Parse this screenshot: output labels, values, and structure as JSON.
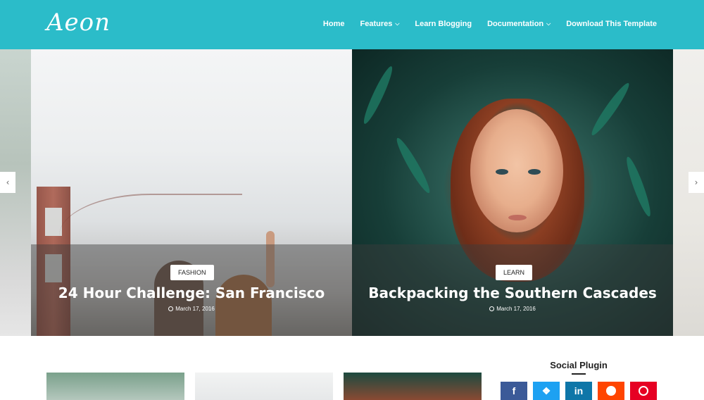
{
  "header": {
    "logo_text": "Aeon",
    "nav": [
      {
        "label": "Home",
        "has_dropdown": false
      },
      {
        "label": "Features",
        "has_dropdown": true
      },
      {
        "label": "Learn Blogging",
        "has_dropdown": false
      },
      {
        "label": "Documentation",
        "has_dropdown": true
      },
      {
        "label": "Download This Template",
        "has_dropdown": false
      }
    ],
    "background_color": "#2bbcc9"
  },
  "slider": {
    "prev_icon": "chevron-left-icon",
    "next_icon": "chevron-right-icon",
    "slides": [
      {
        "tag": "FASHION",
        "title": "24 Hour Challenge: San Francisco",
        "date": "March 17, 2016"
      },
      {
        "tag": "LEARN",
        "title": "Backpacking the Southern Cascades",
        "date": "March 17, 2016"
      }
    ]
  },
  "sidebar": {
    "widget_title": "Social Plugin",
    "social": [
      {
        "name": "facebook-icon",
        "color": "#3b5a98"
      },
      {
        "name": "twitter-icon",
        "color": "#1da1f2"
      },
      {
        "name": "linkedin-icon",
        "color": "#0e76a8"
      },
      {
        "name": "reddit-icon",
        "color": "#ff4500"
      },
      {
        "name": "pinterest-icon",
        "color": "#e60023"
      }
    ]
  }
}
